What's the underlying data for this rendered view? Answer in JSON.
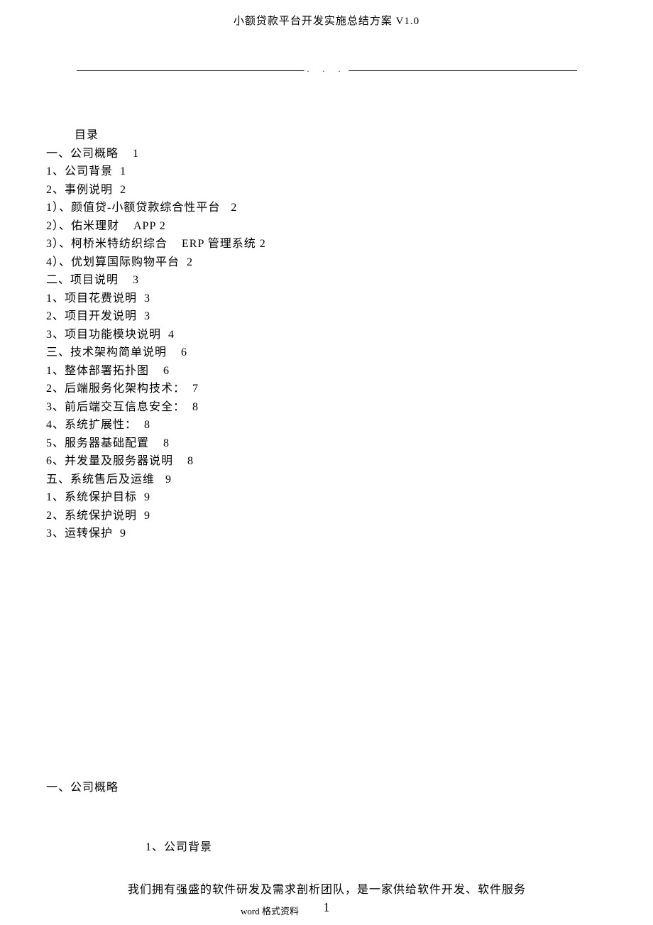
{
  "header": {
    "title": "小额贷款平台开发实施总结方案 V1.0"
  },
  "decor": {
    "dots": ".   .   ."
  },
  "toc": {
    "heading": "目录",
    "lines": [
      "一、公司概略    1",
      "1、公司背景  1",
      "2、事例说明  2",
      "1）、颜值贷-小额贷款综合性平台   2",
      "2）、佑米理财    APP 2",
      "3）、柯桥米特纺织综合    ERP 管理系统 2",
      "4）、优划算国际购物平台  2",
      "二、项目说明    3",
      "1、项目花费说明  3",
      "2、项目开发说明  3",
      "3、项目功能模块说明  4",
      "三、技术架构简单说明    6",
      "1、整体部署拓扑图    6",
      "2、后端服务化架构技术：  7",
      "3、前后端交互信息安全：  8",
      "4、系统扩展性：  8",
      "5、服务器基础配置    8",
      "6、并发量及服务器说明    8",
      "五、系统售后及运维   9",
      "1、系统保护目标  9",
      "2、系统保护说明  9",
      "3、运转保护  9"
    ]
  },
  "body": {
    "section_title": "一、公司概略",
    "subsection_title": "1、公司背景",
    "paragraph": "我们拥有强盛的软件研发及需求剖析团队，是一家供给软件开发、软件服务",
    "footer_note": "word 格式资料"
  },
  "page_number": "1"
}
